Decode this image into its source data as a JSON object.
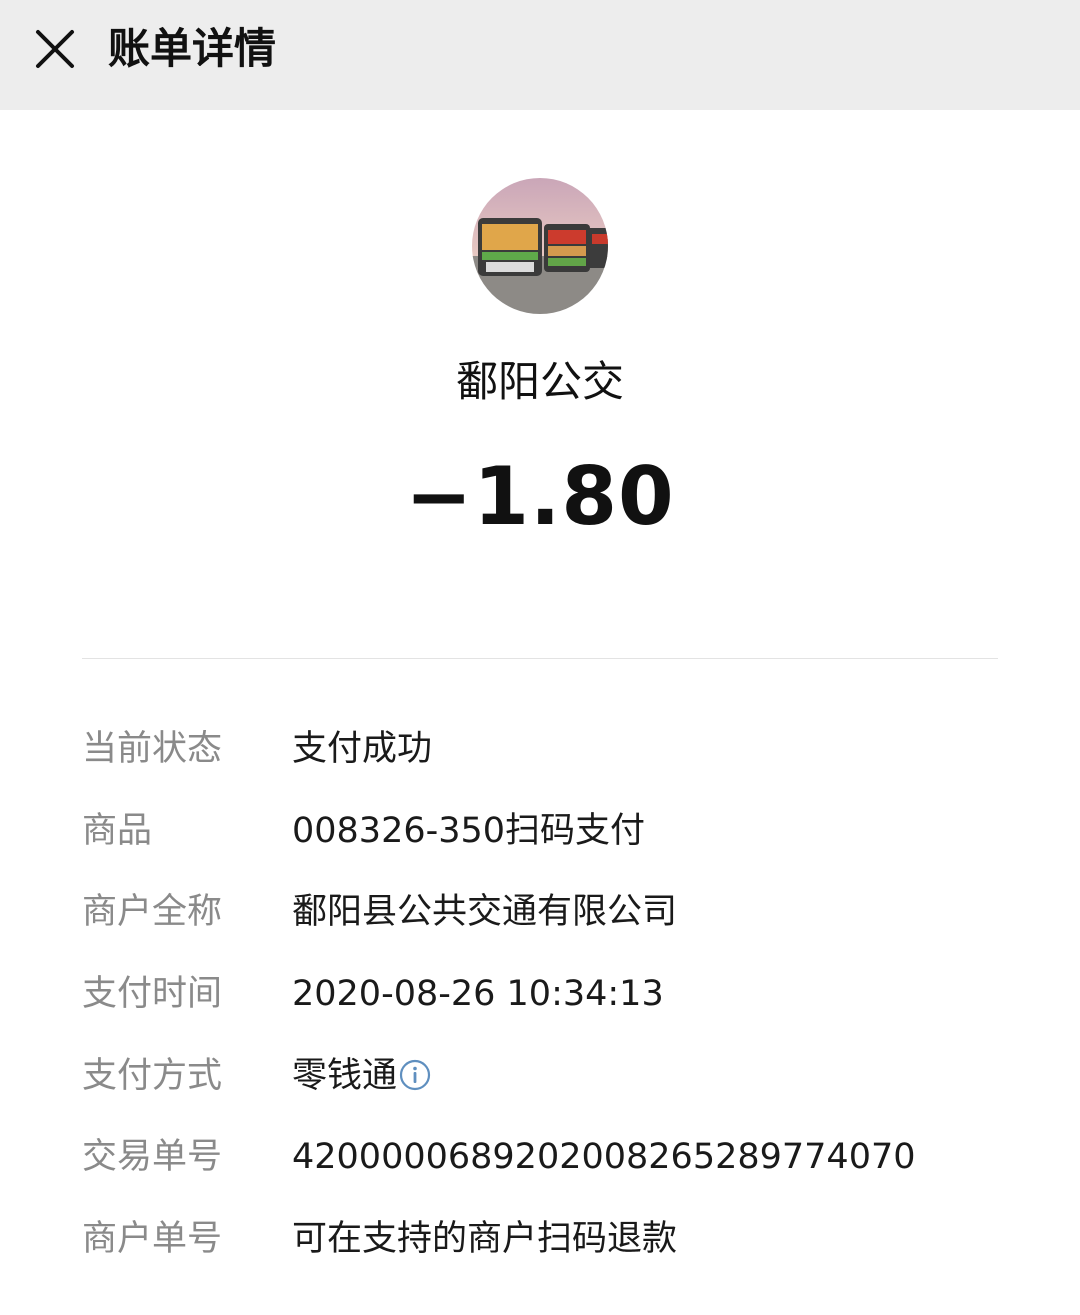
{
  "header": {
    "title": "账单详情",
    "close_icon": "close-icon"
  },
  "merchant": {
    "avatar_icon": "bus-photo-avatar",
    "name": "鄱阳公交",
    "amount": "−1.80"
  },
  "details": [
    {
      "label": "当前状态",
      "value": "支付成功"
    },
    {
      "label": "商品",
      "value": "008326-350扫码支付"
    },
    {
      "label": "商户全称",
      "value": "鄱阳县公共交通有限公司"
    },
    {
      "label": "支付时间",
      "value": "2020-08-26 10:34:13"
    },
    {
      "label": "支付方式",
      "value": "零钱通",
      "icon": "info-icon"
    },
    {
      "label": "交易单号",
      "value": "4200000689202008265289774070"
    },
    {
      "label": "商户单号",
      "value": "可在支持的商户扫码退款"
    }
  ],
  "colors": {
    "header_bg": "#ededed",
    "label": "#8a8a8a",
    "value": "#1a1a1a",
    "info_icon": "#5f8fbf"
  }
}
